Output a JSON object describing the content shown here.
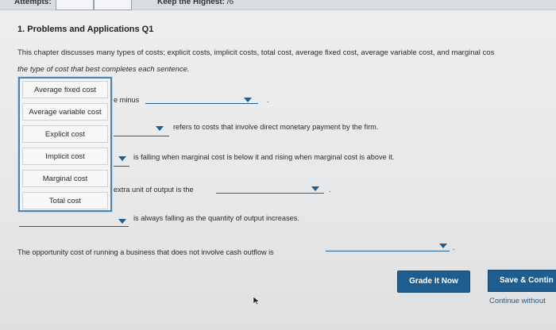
{
  "header": {
    "attempts_label": "Attempts:",
    "keep_label": "Keep the Highest:",
    "keep_value": "/6"
  },
  "question": {
    "title": "1. Problems and Applications Q1",
    "intro": "This chapter discusses many types of costs: explicit costs, implicit costs, total cost, average fixed cost, average variable cost, and marginal cos",
    "intro2": "the type of cost that best completes each sentence."
  },
  "word_bank": [
    "Average fixed cost",
    "Average variable cost",
    "Explicit cost",
    "Implicit cost",
    "Marginal cost",
    "Total cost"
  ],
  "sentences": {
    "s1": "e minus",
    "s2": "refers to costs that involve direct monetary payment by the firm.",
    "s3": "is falling when marginal cost is below it and rising when marginal cost is above it.",
    "s4": "extra unit of output is the",
    "s5": "is always falling as the quantity of output increases.",
    "s6": "The opportunity cost of running a business that does not involve cash outflow is"
  },
  "buttons": {
    "grade": "Grade It Now",
    "save": "Save & Contin",
    "continue": "Continue without"
  },
  "colors": {
    "accent": "#1e5d8e",
    "bank_border": "#4c83b5"
  }
}
